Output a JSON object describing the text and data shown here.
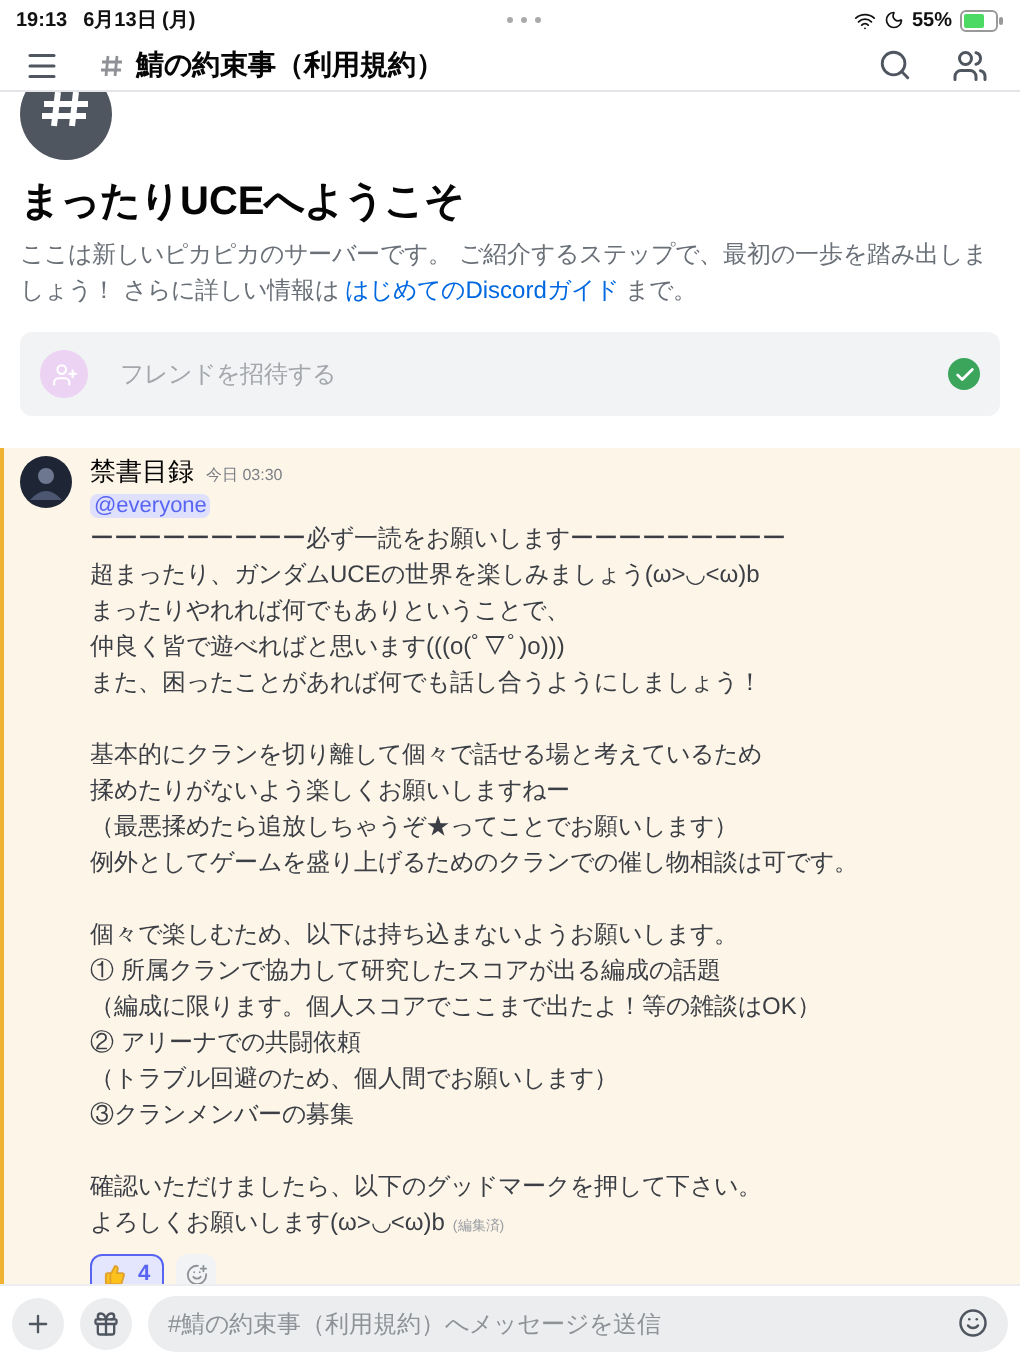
{
  "status_bar": {
    "time": "19:13",
    "date": "6月13日 (月)",
    "battery": "55%"
  },
  "header": {
    "channel": "鯖の約束事（利用規約）"
  },
  "welcome": {
    "title": "まったりUCEへようこそ",
    "text": "ここは新しいピカピカのサーバーです。 ご紹介するステップで、最初の一歩を踏み出しましょう！ さらに詳しい情報は",
    "link": "はじめてのDiscordガイド",
    "text_after": "まで。"
  },
  "invite_card": {
    "label": "フレンドを招待する",
    "checked": true
  },
  "message": {
    "author": "禁書目録",
    "time": "今日 03:30",
    "mention": "@everyone",
    "highlighted": true,
    "paragraphs": [
      [
        "ーーーーーーーーー必ず一読をお願いしますーーーーーーーーー",
        "超まったり、ガンダムUCEの世界を楽しみましょう(ω>◡<ω)b",
        "まったりやれれば何でもありということで、",
        "仲良く皆で遊べればと思います(((o(ﾟ▽ﾟ)o)))",
        "また、困ったことがあれば何でも話し合うようにしましょう！"
      ],
      [
        "基本的にクランを切り離して個々で話せる場と考えているため",
        "揉めたりがないよう楽しくお願いしますねー",
        "（最悪揉めたら追放しちゃうぞ★ってことでお願いします）",
        "例外としてゲームを盛り上げるためのクランでの催し物相談は可です。"
      ],
      [
        "個々で楽しむため、以下は持ち込まないようお願いします。",
        "① 所属クランで協力して研究したスコアが出る編成の話題",
        "（編成に限ります。個人スコアでここまで出たよ！等の雑談はOK）",
        "② アリーナでの共闘依頼",
        "（トラブル回避のため、個人間でお願いします）",
        "③クランメンバーの募集"
      ],
      [
        "確認いただけましたら、以下のグッドマークを押して下さい。",
        "よろしくお願いします(ω>◡<ω)b"
      ]
    ],
    "edited": "(編集済)",
    "reactions": [
      {
        "count": "4",
        "selected": true
      }
    ]
  },
  "composer": {
    "placeholder": "#鯖の約束事（利用規約）へメッセージを送信"
  }
}
